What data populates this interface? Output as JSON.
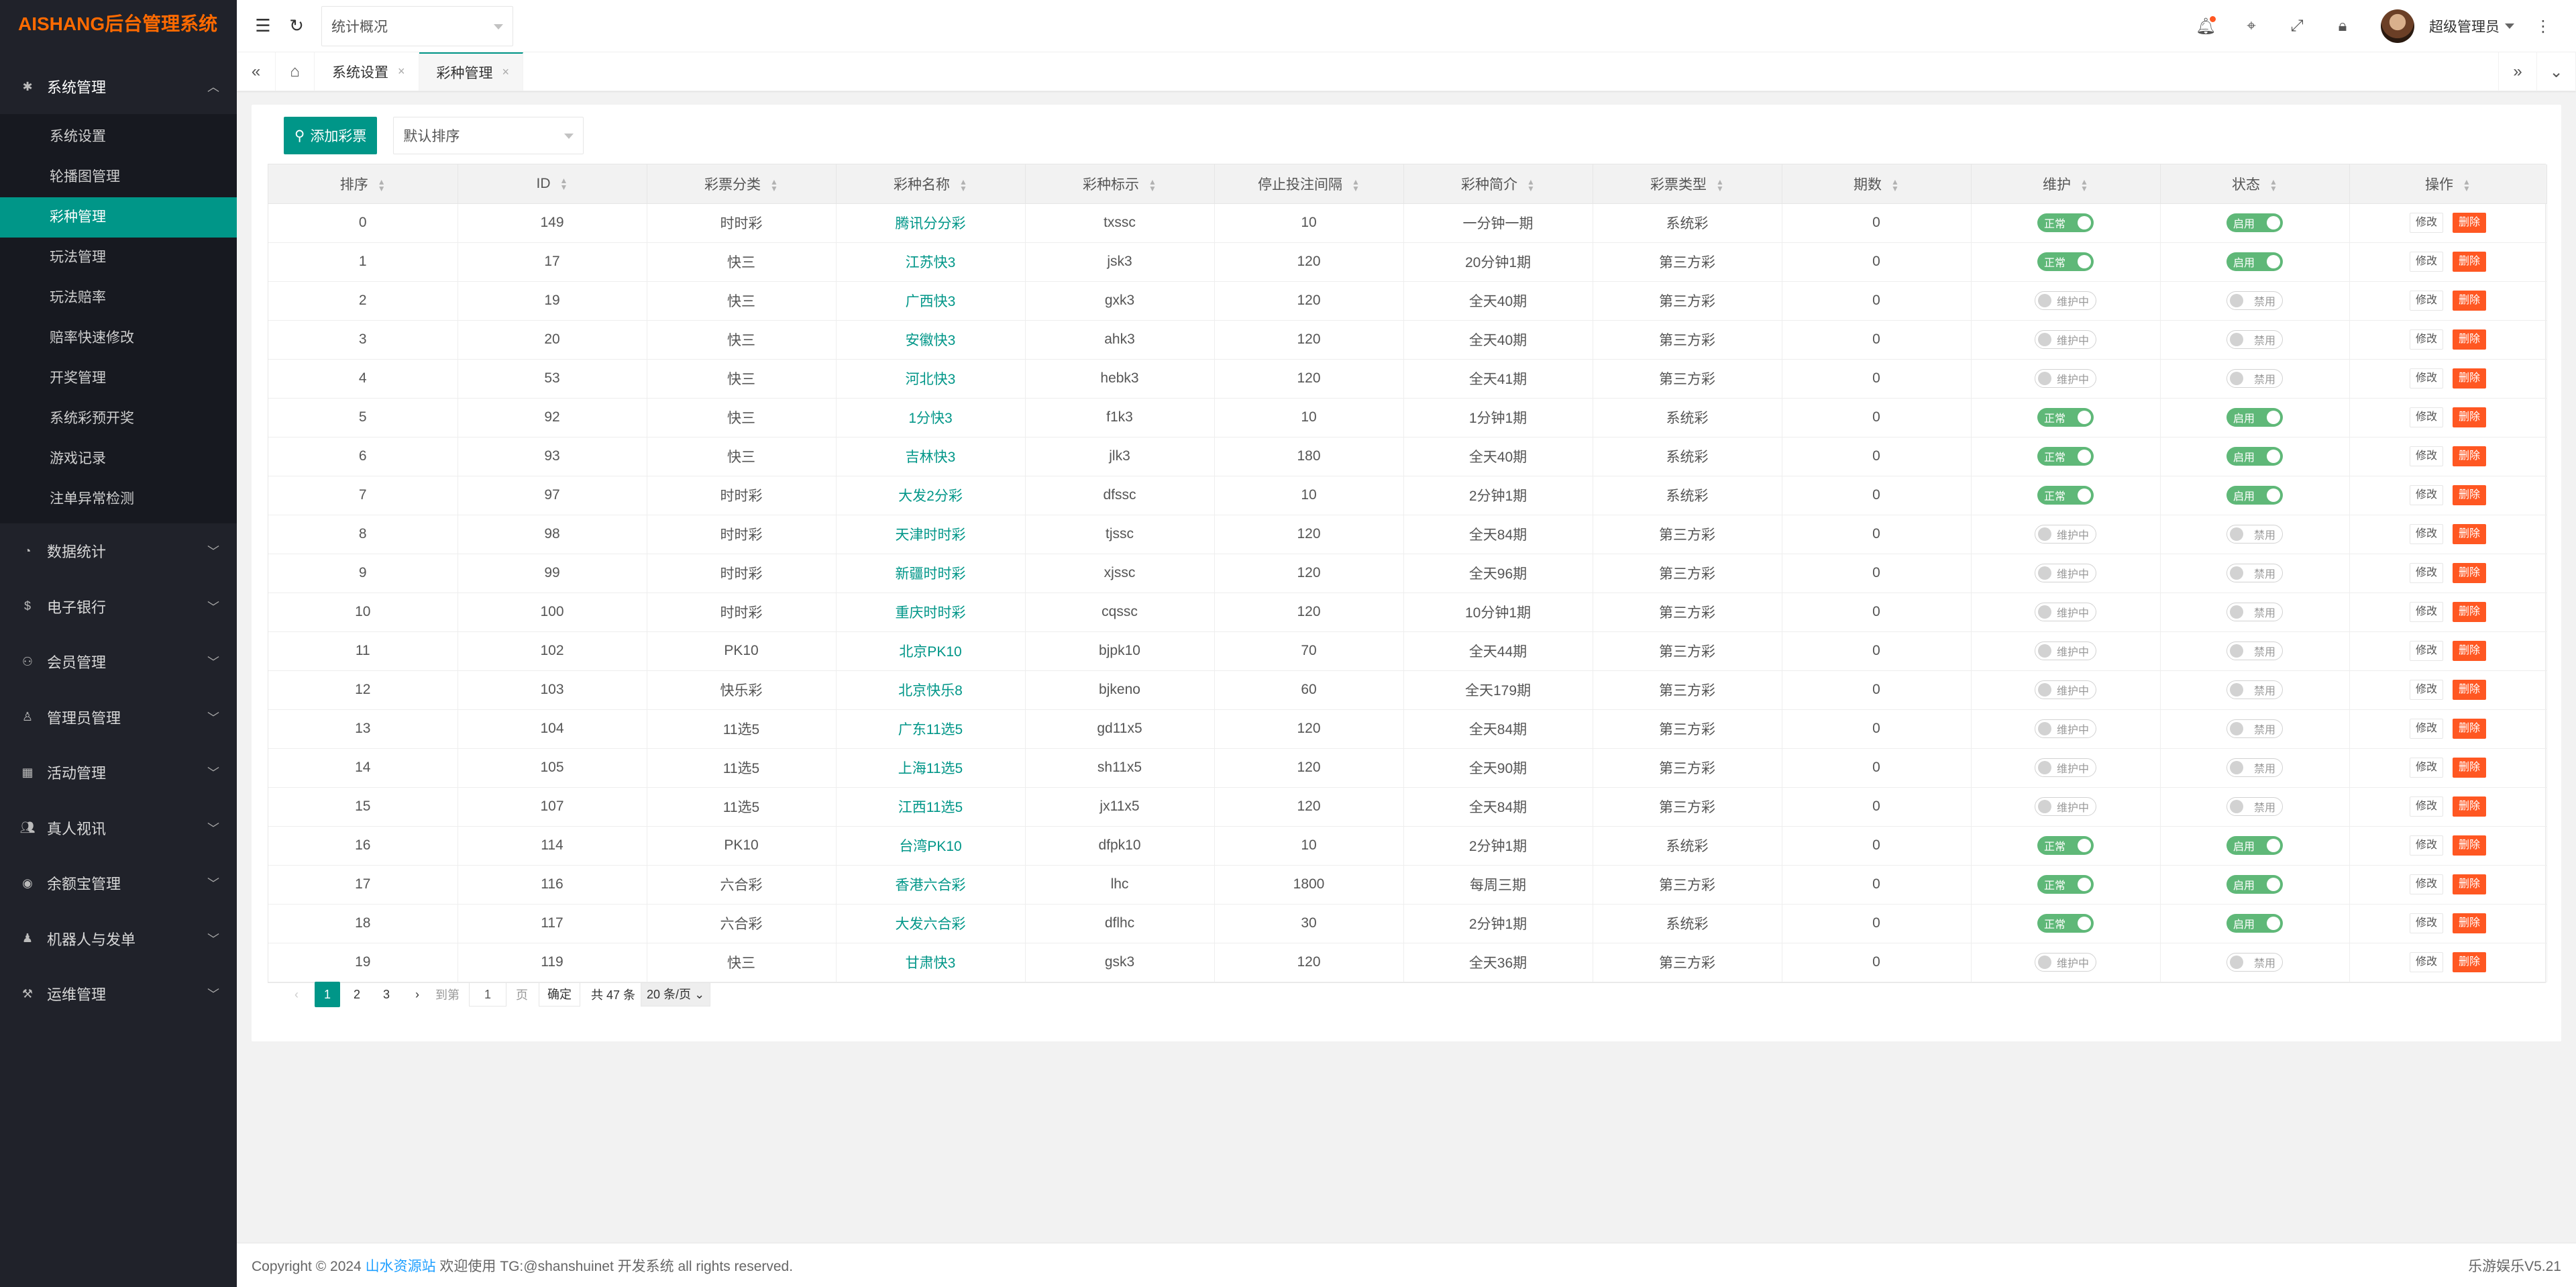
{
  "brand": {
    "logo": "AISHANG后台管理系统"
  },
  "sidebar": {
    "open_group": {
      "label": "系统管理",
      "icon": "gear-icon"
    },
    "items": [
      "系统设置",
      "轮播图管理",
      "彩种管理",
      "玩法管理",
      "玩法赔率",
      "赔率快速修改",
      "开奖管理",
      "系统彩预开奖",
      "游戏记录",
      "注单异常检测"
    ],
    "active_index": 2,
    "groups": [
      {
        "label": "数据统计",
        "icon": "dashboard-icon"
      },
      {
        "label": "电子银行",
        "icon": "dollar-icon"
      },
      {
        "label": "会员管理",
        "icon": "users-icon"
      },
      {
        "label": "管理员管理",
        "icon": "user-icon"
      },
      {
        "label": "活动管理",
        "icon": "calendar-icon"
      },
      {
        "label": "真人视讯",
        "icon": "group-icon"
      },
      {
        "label": "余额宝管理",
        "icon": "wallet-icon"
      },
      {
        "label": "机器人与发单",
        "icon": "robot-icon"
      },
      {
        "label": "运维管理",
        "icon": "tools-icon"
      }
    ]
  },
  "header": {
    "quick_select": "统计概况",
    "user_name": "超级管理员"
  },
  "tabs": {
    "items": [
      {
        "label": "系统设置",
        "active": false
      },
      {
        "label": "彩种管理",
        "active": true
      }
    ]
  },
  "toolbar": {
    "add_label": "添加彩票",
    "sort_select": "默认排序"
  },
  "table": {
    "columns": [
      "排序",
      "ID",
      "彩票分类",
      "彩种名称",
      "彩种标示",
      "停止投注间隔",
      "彩种简介",
      "彩票类型",
      "期数",
      "维护",
      "状态",
      "操作"
    ],
    "rows": [
      {
        "sort": "0",
        "id": "149",
        "cat": "时时彩",
        "name": "腾讯分分彩",
        "code": "txssc",
        "interval": "10",
        "intro": "一分钟一期",
        "type": "系统彩",
        "periods": "0",
        "active": true
      },
      {
        "sort": "1",
        "id": "17",
        "cat": "快三",
        "name": "江苏快3",
        "code": "jsk3",
        "interval": "120",
        "intro": "20分钟1期",
        "type": "第三方彩",
        "periods": "0",
        "active": true
      },
      {
        "sort": "2",
        "id": "19",
        "cat": "快三",
        "name": "广西快3",
        "code": "gxk3",
        "interval": "120",
        "intro": "全天40期",
        "type": "第三方彩",
        "periods": "0",
        "active": false
      },
      {
        "sort": "3",
        "id": "20",
        "cat": "快三",
        "name": "安徽快3",
        "code": "ahk3",
        "interval": "120",
        "intro": "全天40期",
        "type": "第三方彩",
        "periods": "0",
        "active": false
      },
      {
        "sort": "4",
        "id": "53",
        "cat": "快三",
        "name": "河北快3",
        "code": "hebk3",
        "interval": "120",
        "intro": "全天41期",
        "type": "第三方彩",
        "periods": "0",
        "active": false
      },
      {
        "sort": "5",
        "id": "92",
        "cat": "快三",
        "name": "1分快3",
        "code": "f1k3",
        "interval": "10",
        "intro": "1分钟1期",
        "type": "系统彩",
        "periods": "0",
        "active": true
      },
      {
        "sort": "6",
        "id": "93",
        "cat": "快三",
        "name": "吉林快3",
        "code": "jlk3",
        "interval": "180",
        "intro": "全天40期",
        "type": "系统彩",
        "periods": "0",
        "active": true
      },
      {
        "sort": "7",
        "id": "97",
        "cat": "时时彩",
        "name": "大发2分彩",
        "code": "dfssc",
        "interval": "10",
        "intro": "2分钟1期",
        "type": "系统彩",
        "periods": "0",
        "active": true
      },
      {
        "sort": "8",
        "id": "98",
        "cat": "时时彩",
        "name": "天津时时彩",
        "code": "tjssc",
        "interval": "120",
        "intro": "全天84期",
        "type": "第三方彩",
        "periods": "0",
        "active": false
      },
      {
        "sort": "9",
        "id": "99",
        "cat": "时时彩",
        "name": "新疆时时彩",
        "code": "xjssc",
        "interval": "120",
        "intro": "全天96期",
        "type": "第三方彩",
        "periods": "0",
        "active": false
      },
      {
        "sort": "10",
        "id": "100",
        "cat": "时时彩",
        "name": "重庆时时彩",
        "code": "cqssc",
        "interval": "120",
        "intro": "10分钟1期",
        "type": "第三方彩",
        "periods": "0",
        "active": false
      },
      {
        "sort": "11",
        "id": "102",
        "cat": "PK10",
        "name": "北京PK10",
        "code": "bjpk10",
        "interval": "70",
        "intro": "全天44期",
        "type": "第三方彩",
        "periods": "0",
        "active": false
      },
      {
        "sort": "12",
        "id": "103",
        "cat": "快乐彩",
        "name": "北京快乐8",
        "code": "bjkeno",
        "interval": "60",
        "intro": "全天179期",
        "type": "第三方彩",
        "periods": "0",
        "active": false
      },
      {
        "sort": "13",
        "id": "104",
        "cat": "11选5",
        "name": "广东11选5",
        "code": "gd11x5",
        "interval": "120",
        "intro": "全天84期",
        "type": "第三方彩",
        "periods": "0",
        "active": false
      },
      {
        "sort": "14",
        "id": "105",
        "cat": "11选5",
        "name": "上海11选5",
        "code": "sh11x5",
        "interval": "120",
        "intro": "全天90期",
        "type": "第三方彩",
        "periods": "0",
        "active": false
      },
      {
        "sort": "15",
        "id": "107",
        "cat": "11选5",
        "name": "江西11选5",
        "code": "jx11x5",
        "interval": "120",
        "intro": "全天84期",
        "type": "第三方彩",
        "periods": "0",
        "active": false
      },
      {
        "sort": "16",
        "id": "114",
        "cat": "PK10",
        "name": "台湾PK10",
        "code": "dfpk10",
        "interval": "10",
        "intro": "2分钟1期",
        "type": "系统彩",
        "periods": "0",
        "active": true
      },
      {
        "sort": "17",
        "id": "116",
        "cat": "六合彩",
        "name": "香港六合彩",
        "code": "lhc",
        "interval": "1800",
        "intro": "每周三期",
        "type": "第三方彩",
        "periods": "0",
        "active": true
      },
      {
        "sort": "18",
        "id": "117",
        "cat": "六合彩",
        "name": "大发六合彩",
        "code": "dflhc",
        "interval": "30",
        "intro": "2分钟1期",
        "type": "系统彩",
        "periods": "0",
        "active": true
      },
      {
        "sort": "19",
        "id": "119",
        "cat": "快三",
        "name": "甘肃快3",
        "code": "gsk3",
        "interval": "120",
        "intro": "全天36期",
        "type": "第三方彩",
        "periods": "0",
        "active": false
      }
    ],
    "labels": {
      "maint_on": "正常",
      "maint_off": "维护中",
      "status_on": "启用",
      "status_off": "禁用",
      "edit": "修改",
      "delete": "删除"
    }
  },
  "pager": {
    "pages": [
      "1",
      "2",
      "3"
    ],
    "current": "1",
    "goto_label": "到第",
    "goto_value": "1",
    "page_unit": "页",
    "confirm": "确定",
    "total": "共 47 条",
    "page_size": "20 条/页"
  },
  "footer": {
    "prefix": "Copyright © 2024",
    "link": "山水资源站",
    "suffix": "欢迎使用 TG:@shanshuinet 开发系统 all rights reserved.",
    "version": "乐游娱乐V5.21"
  },
  "colors": {
    "accent": "#009688",
    "danger": "#ff5722",
    "switch_on": "#5fb878",
    "sidebar_bg": "#20222a",
    "logo": "#ff6a00"
  }
}
